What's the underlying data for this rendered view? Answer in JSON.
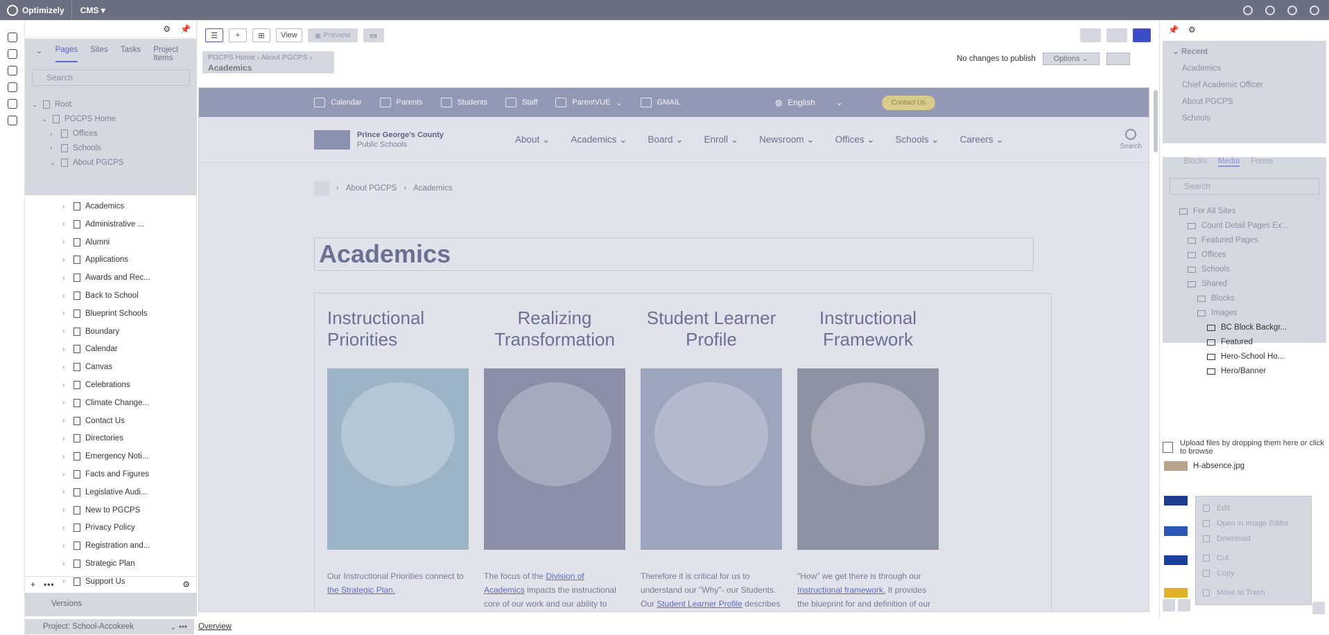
{
  "topbar": {
    "logo": "Optimizely",
    "cms": "CMS"
  },
  "pagetree": {
    "tabs": [
      "Pages",
      "Sites",
      "Tasks",
      "Project Items"
    ],
    "search_placeholder": "Search",
    "root_items": [
      {
        "label": "Root",
        "level": 0
      },
      {
        "label": "PGCPS Home",
        "level": 1
      },
      {
        "label": "Offices",
        "level": 2
      },
      {
        "label": "Schools",
        "level": 2
      },
      {
        "label": "About PGCPS",
        "level": 2
      }
    ],
    "items": [
      "Academics",
      "Administrative ...",
      "Alumni",
      "Applications",
      "Awards and Rec...",
      "Back to School",
      "Blueprint Schools",
      "Boundary",
      "Calendar",
      "Canvas",
      "Celebrations",
      "Climate Change...",
      "Contact Us",
      "Directories",
      "Emergency Noti...",
      "Facts and Figures",
      "Legislative Audi...",
      "New to PGCPS",
      "Privacy Policy",
      "Registration and...",
      "Strategic Plan",
      "Support Us"
    ]
  },
  "versions": {
    "label": "Versions"
  },
  "project": {
    "label": "Project: School-Accokeek",
    "overview": "Overview"
  },
  "toolbar": {
    "view": "View",
    "preview": "Preview"
  },
  "breadcrumb": {
    "path": [
      "PGCPS Home",
      "About PGCPS"
    ],
    "title": "Academics"
  },
  "publish": {
    "status": "No changes to publish",
    "options": "Options"
  },
  "site": {
    "topnav": [
      "Calendar",
      "Parents",
      "Students",
      "Staff",
      "ParentVUE",
      "GMAIL"
    ],
    "language": "English",
    "contact": "Contact Us",
    "logo_line1": "Prince George's County",
    "logo_line2": "Public Schools",
    "mainnav": [
      "About",
      "Academics",
      "Board",
      "Enroll",
      "Newsroom",
      "Offices",
      "Schools",
      "Careers"
    ],
    "search": "Search",
    "crumbs": [
      "About PGCPS",
      "Academics"
    ],
    "title": "Academics",
    "cards": [
      {
        "title": "Instructional Priorities",
        "text": "Our Instructional Priorities connect to ",
        "link": "the Strategic Plan.",
        "color": "#9db3c6"
      },
      {
        "title": "Realizing Transformation",
        "text": "The focus of the ",
        "link": "Division of Academics",
        "rest": " impacts the instructional core of our work and our ability to",
        "color": "#8b8fa8"
      },
      {
        "title": "Student Learner Profile",
        "text": "Therefore it is critical for us to understand our \"Why\"- our Students. Our ",
        "link": "Student Learner Profile",
        "rest": " describes",
        "color": "#9ca5bb"
      },
      {
        "title": "Instructional Framework",
        "text": "\"How\" we get there is through our ",
        "link": "Instructional framework.",
        "rest": " It provides the blueprint for and definition of our",
        "color": "#8f92a3"
      }
    ]
  },
  "recent": {
    "title": "Recent",
    "items": [
      "Academics",
      "Chief Academic Officer",
      "About PGCPS",
      "Schools"
    ]
  },
  "assets": {
    "tabs": [
      "Blocks",
      "Media",
      "Forms"
    ],
    "search_placeholder": "Search",
    "folders": [
      {
        "label": "For All Sites",
        "x": 28,
        "faded": true
      },
      {
        "label": "Count Detail Pages Ex...",
        "x": 40,
        "faded": true
      },
      {
        "label": "Featured Pages",
        "x": 40,
        "faded": true
      },
      {
        "label": "Offices",
        "x": 40,
        "faded": true
      },
      {
        "label": "Schools",
        "x": 40,
        "faded": true
      },
      {
        "label": "Shared",
        "x": 40,
        "faded": true
      },
      {
        "label": "Blocks",
        "x": 54,
        "faded": true
      },
      {
        "label": "Images",
        "x": 54,
        "faded": true
      },
      {
        "label": "BC Block Backgr...",
        "x": 68,
        "faded": false
      },
      {
        "label": "Featured",
        "x": 68,
        "faded": false
      },
      {
        "label": "Hero-School Ho...",
        "x": 68,
        "faded": false
      },
      {
        "label": "Hero/Banner",
        "x": 68,
        "faded": false
      }
    ]
  },
  "upload": {
    "text": "Upload files by dropping them here or click to browse"
  },
  "media": {
    "first_file": "H-absence.jpg"
  },
  "context_menu": [
    "Edit",
    "Open in Image Editor",
    "Download",
    "Cut",
    "Copy",
    "Move to Trash"
  ]
}
